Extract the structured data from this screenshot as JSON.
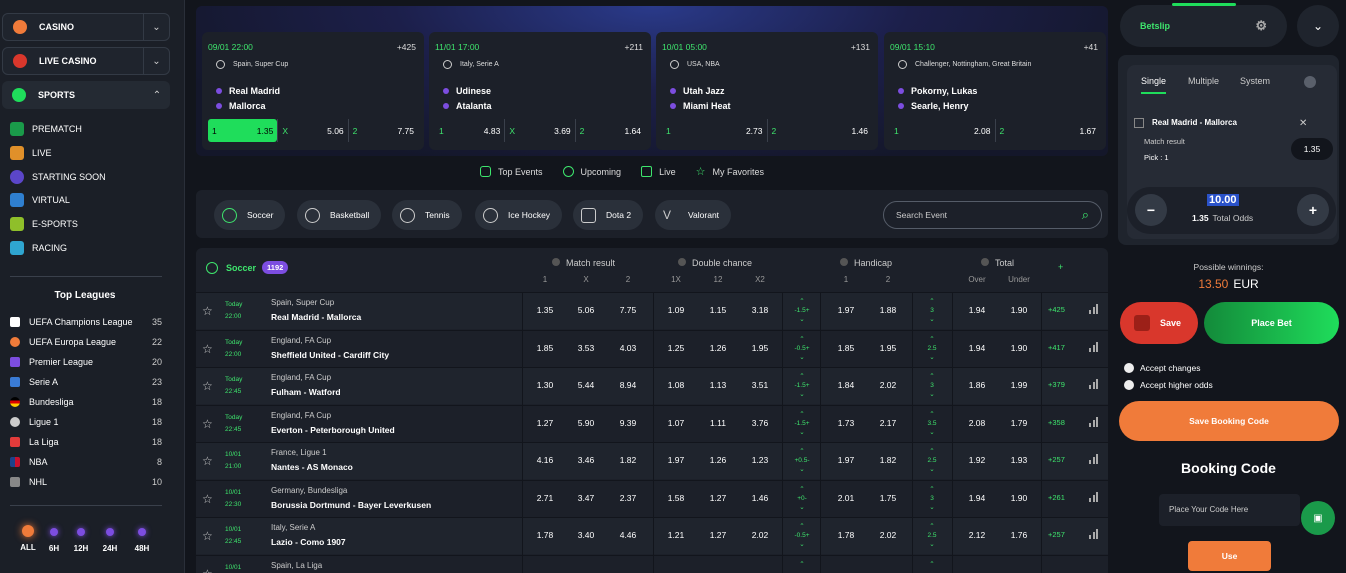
{
  "sidebar": {
    "groups": [
      {
        "label": "CASINO"
      },
      {
        "label": "LIVE CASINO"
      },
      {
        "label": "SPORTS"
      }
    ],
    "sub": [
      {
        "label": "PREMATCH"
      },
      {
        "label": "LIVE"
      },
      {
        "label": "STARTING SOON"
      },
      {
        "label": "VIRTUAL"
      },
      {
        "label": "E-SPORTS"
      },
      {
        "label": "RACING"
      }
    ],
    "top_leagues_title": "Top Leagues",
    "leagues": [
      {
        "name": "UEFA Champions League",
        "count": "35"
      },
      {
        "name": "UEFA Europa League",
        "count": "22"
      },
      {
        "name": "Premier League",
        "count": "20"
      },
      {
        "name": "Serie A",
        "count": "23"
      },
      {
        "name": "Bundesliga",
        "count": "18"
      },
      {
        "name": "Ligue 1",
        "count": "18"
      },
      {
        "name": "La Liga",
        "count": "18"
      },
      {
        "name": "NBA",
        "count": "8"
      },
      {
        "name": "NHL",
        "count": "10"
      }
    ],
    "time_filters": [
      "ALL",
      "6H",
      "12H",
      "24H",
      "48H"
    ]
  },
  "featured": [
    {
      "datetime": "09/01 22:00",
      "more": "+425",
      "competition": "Spain, Super Cup",
      "team1": "Real Madrid",
      "team2": "Mallorca",
      "odds": [
        {
          "l": "1",
          "v": "1.35"
        },
        {
          "l": "X",
          "v": "5.06"
        },
        {
          "l": "2",
          "v": "7.75"
        }
      ]
    },
    {
      "datetime": "11/01 17:00",
      "more": "+211",
      "competition": "Italy, Serie A",
      "team1": "Udinese",
      "team2": "Atalanta",
      "odds": [
        {
          "l": "1",
          "v": "4.83"
        },
        {
          "l": "X",
          "v": "3.69"
        },
        {
          "l": "2",
          "v": "1.64"
        }
      ]
    },
    {
      "datetime": "10/01 05:00",
      "more": "+131",
      "competition": "USA, NBA",
      "team1": "Utah Jazz",
      "team2": "Miami Heat",
      "odds": [
        {
          "l": "1",
          "v": "2.73"
        },
        {
          "l": "2",
          "v": "1.46"
        }
      ]
    },
    {
      "datetime": "09/01 15:10",
      "more": "+41",
      "competition": "Challenger, Nottingham, Great Britain",
      "team1": "Pokorny, Lukas",
      "team2": "Searle, Henry",
      "odds": [
        {
          "l": "1",
          "v": "2.08"
        },
        {
          "l": "2",
          "v": "1.67"
        }
      ]
    }
  ],
  "tabs": [
    "Top Events",
    "Upcoming",
    "Live",
    "My Favorites"
  ],
  "sports": [
    "Soccer",
    "Basketball",
    "Tennis",
    "Ice Hockey",
    "Dota 2",
    "Valorant"
  ],
  "search_placeholder": "Search Event",
  "table": {
    "sport": "Soccer",
    "count": "1192",
    "groups": [
      "Match result",
      "Double chance",
      "Handicap",
      "Total"
    ],
    "plus": "+",
    "subs": [
      "1",
      "X",
      "2",
      "1X",
      "12",
      "X2",
      "1",
      "2",
      "Over",
      "Under"
    ],
    "rows": [
      {
        "d1": "Today",
        "d2": "22:00",
        "comp": "Spain, Super Cup",
        "teams": "Real Madrid  -  Mallorca",
        "o": [
          "1.35",
          "5.06",
          "7.75",
          "1.09",
          "1.15",
          "3.18"
        ],
        "h": "-1.5+",
        "hh": [
          "1.97",
          "1.88"
        ],
        "t": "3",
        "tt": [
          "1.94",
          "1.90"
        ],
        "more": "+425"
      },
      {
        "d1": "Today",
        "d2": "22:00",
        "comp": "England, FA Cup",
        "teams": "Sheffield United  -  Cardiff City",
        "o": [
          "1.85",
          "3.53",
          "4.03",
          "1.25",
          "1.26",
          "1.95"
        ],
        "h": "-0.5+",
        "hh": [
          "1.85",
          "1.95"
        ],
        "t": "2.5",
        "tt": [
          "1.94",
          "1.90"
        ],
        "more": "+417"
      },
      {
        "d1": "Today",
        "d2": "22:45",
        "comp": "England, FA Cup",
        "teams": "Fulham  -  Watford",
        "o": [
          "1.30",
          "5.44",
          "8.94",
          "1.08",
          "1.13",
          "3.51"
        ],
        "h": "-1.5+",
        "hh": [
          "1.84",
          "2.02"
        ],
        "t": "3",
        "tt": [
          "1.86",
          "1.99"
        ],
        "more": "+379"
      },
      {
        "d1": "Today",
        "d2": "22:45",
        "comp": "England, FA Cup",
        "teams": "Everton  -  Peterborough United",
        "o": [
          "1.27",
          "5.90",
          "9.39",
          "1.07",
          "1.11",
          "3.76"
        ],
        "h": "-1.5+",
        "hh": [
          "1.73",
          "2.17"
        ],
        "t": "3.5",
        "tt": [
          "2.08",
          "1.79"
        ],
        "more": "+358"
      },
      {
        "d1": "10/01",
        "d2": "21:00",
        "comp": "France, Ligue 1",
        "teams": "Nantes  -  AS Monaco",
        "o": [
          "4.16",
          "3.46",
          "1.82",
          "1.97",
          "1.26",
          "1.23"
        ],
        "h": "+0.5-",
        "hh": [
          "1.97",
          "1.82"
        ],
        "t": "2.5",
        "tt": [
          "1.92",
          "1.93"
        ],
        "more": "+257"
      },
      {
        "d1": "10/01",
        "d2": "22:30",
        "comp": "Germany, Bundesliga",
        "teams": "Borussia Dortmund  -  Bayer Leverkusen",
        "o": [
          "2.71",
          "3.47",
          "2.37",
          "1.58",
          "1.27",
          "1.46"
        ],
        "h": "+0-",
        "hh": [
          "2.01",
          "1.75"
        ],
        "t": "3",
        "tt": [
          "1.94",
          "1.90"
        ],
        "more": "+261"
      },
      {
        "d1": "10/01",
        "d2": "22:45",
        "comp": "Italy, Serie A",
        "teams": "Lazio  -  Como 1907",
        "o": [
          "1.78",
          "3.40",
          "4.46",
          "1.21",
          "1.27",
          "2.02"
        ],
        "h": "-0.5+",
        "hh": [
          "1.78",
          "2.02"
        ],
        "t": "2.5",
        "tt": [
          "2.12",
          "1.76"
        ],
        "more": "+257"
      },
      {
        "d1": "10/01",
        "d2": "",
        "comp": "Spain, La Liga",
        "teams": "",
        "o": [
          "",
          "",
          "",
          "",
          "",
          ""
        ],
        "h": "",
        "hh": [
          "",
          ""
        ],
        "t": "",
        "tt": [
          "",
          ""
        ],
        "more": ""
      }
    ]
  },
  "betslip": {
    "title": "Betslip",
    "tabs": [
      "Single",
      "Multiple",
      "System"
    ],
    "selection": "Real Madrid - Mallorca",
    "close": "✕",
    "market": "Match result",
    "pick": "Pick : 1",
    "odd": "1.35",
    "stake": "10.00",
    "total_odds_value": "1.35",
    "total_odds_label": "Total Odds",
    "minus": "−",
    "plus": "+",
    "possible_label": "Possible winnings:",
    "possible_value": "13.50",
    "currency": "EUR",
    "save": "Save",
    "place": "Place Bet",
    "accept_changes": "Accept changes",
    "accept_higher": "Accept higher odds",
    "save_booking": "Save Booking Code",
    "booking_title": "Booking Code",
    "booking_placeholder": "Place Your Code Here",
    "use": "Use"
  },
  "colors": {
    "accent": "#1fdd5b",
    "orange": "#f07b3a",
    "purple": "#7c4de0",
    "bg": "#12151c"
  }
}
